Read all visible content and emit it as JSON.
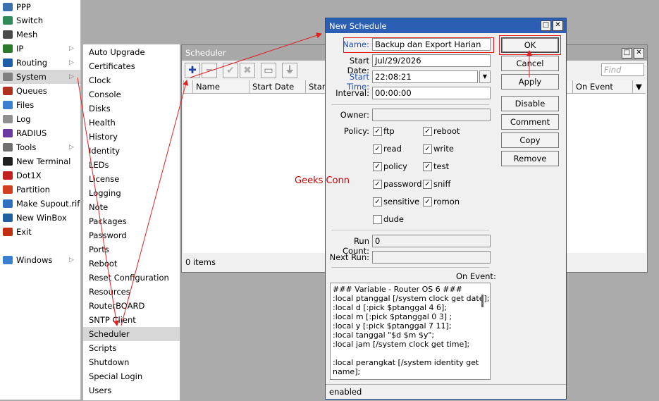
{
  "main_menu": [
    {
      "label": "PPP",
      "icon": "ppp-icon",
      "color": "#3a6fb0"
    },
    {
      "label": "Switch",
      "icon": "switch-icon",
      "color": "#2e8b57"
    },
    {
      "label": "Mesh",
      "icon": "mesh-icon",
      "color": "#4a4a4a"
    },
    {
      "label": "IP",
      "icon": "ip-icon",
      "color": "#2a7a2a",
      "submenu": true
    },
    {
      "label": "Routing",
      "icon": "routing-icon",
      "color": "#1e5ea8",
      "submenu": true
    },
    {
      "label": "System",
      "icon": "gear-icon",
      "color": "#808080",
      "submenu": true
    },
    {
      "label": "Queues",
      "icon": "queues-icon",
      "color": "#b03020"
    },
    {
      "label": "Files",
      "icon": "folder-icon",
      "color": "#3a7fd0"
    },
    {
      "label": "Log",
      "icon": "log-icon",
      "color": "#909090"
    },
    {
      "label": "RADIUS",
      "icon": "radius-icon",
      "color": "#6a3aa0"
    },
    {
      "label": "Tools",
      "icon": "tools-icon",
      "color": "#707070",
      "submenu": true
    },
    {
      "label": "New Terminal",
      "icon": "terminal-icon",
      "color": "#202020"
    },
    {
      "label": "Dot1X",
      "icon": "dot1x-icon",
      "color": "#c02020"
    },
    {
      "label": "Partition",
      "icon": "partition-icon",
      "color": "#d04020"
    },
    {
      "label": "Make Supout.rif",
      "icon": "supout-icon",
      "color": "#3070c0"
    },
    {
      "label": "New WinBox",
      "icon": "winbox-icon",
      "color": "#2060a0"
    },
    {
      "label": "Exit",
      "icon": "exit-icon",
      "color": "#c03010"
    },
    {
      "label": "Windows",
      "icon": "windows-icon",
      "color": "#3a7fd0",
      "submenu": true
    }
  ],
  "system_submenu": [
    "Auto Upgrade",
    "Certificates",
    "Clock",
    "Console",
    "Disks",
    "Health",
    "History",
    "Identity",
    "LEDs",
    "License",
    "Logging",
    "Note",
    "Packages",
    "Password",
    "Ports",
    "Reboot",
    "Reset Configuration",
    "Resources",
    "RouterBOARD",
    "SNTP Client",
    "Scheduler",
    "Scripts",
    "Shutdown",
    "Special Login",
    "Users"
  ],
  "scheduler_window": {
    "title": "Scheduler",
    "find_placeholder": "Find",
    "columns": [
      "Name",
      "Start Date",
      "Start",
      "On Event"
    ],
    "items_count": "0 items"
  },
  "new_schedule": {
    "title": "New Schedule",
    "name_label": "Name:",
    "name_value": "Backup dan Export Harian",
    "start_date_label": "Start Date:",
    "start_date_value": "Jul/29/2026",
    "start_time_label": "Start Time:",
    "start_time_value": "22:08:21",
    "interval_label": "Interval:",
    "interval_value": "00:00:00",
    "owner_label": "Owner:",
    "owner_value": "",
    "policy_label": "Policy:",
    "policies": [
      {
        "label": "ftp",
        "checked": true
      },
      {
        "label": "reboot",
        "checked": true
      },
      {
        "label": "read",
        "checked": true
      },
      {
        "label": "write",
        "checked": true
      },
      {
        "label": "policy",
        "checked": true
      },
      {
        "label": "test",
        "checked": true
      },
      {
        "label": "password",
        "checked": true
      },
      {
        "label": "sniff",
        "checked": true
      },
      {
        "label": "sensitive",
        "checked": true
      },
      {
        "label": "romon",
        "checked": true
      },
      {
        "label": "dude",
        "checked": false
      }
    ],
    "run_count_label": "Run Count:",
    "run_count_value": "0",
    "next_run_label": "Next Run:",
    "next_run_value": "",
    "on_event_label": "On Event:",
    "on_event_lines": [
      "### Variable - Router OS 6 ###",
      ":local ptanggal [/system clock get date];",
      ":local d [:pick $ptanggal 4 6];",
      ":local m [:pick $ptanggal 0 3] ;",
      ":local y [:pick $ptanggal 7 11];",
      ":local tanggal \"$d $m $y\";",
      ":local jam [/system clock get time];",
      "",
      ":local perangkat [/system identity get",
      "name];"
    ],
    "buttons": {
      "ok": "OK",
      "cancel": "Cancel",
      "apply": "Apply",
      "disable": "Disable",
      "comment": "Comment",
      "copy": "Copy",
      "remove": "Remove"
    },
    "status": "enabled"
  },
  "watermark": "Geeks Conn",
  "colors": {
    "dialog_title": "#2c5fb4",
    "annotation_red": "#e02020",
    "label_blue": "#1f4fb0"
  }
}
